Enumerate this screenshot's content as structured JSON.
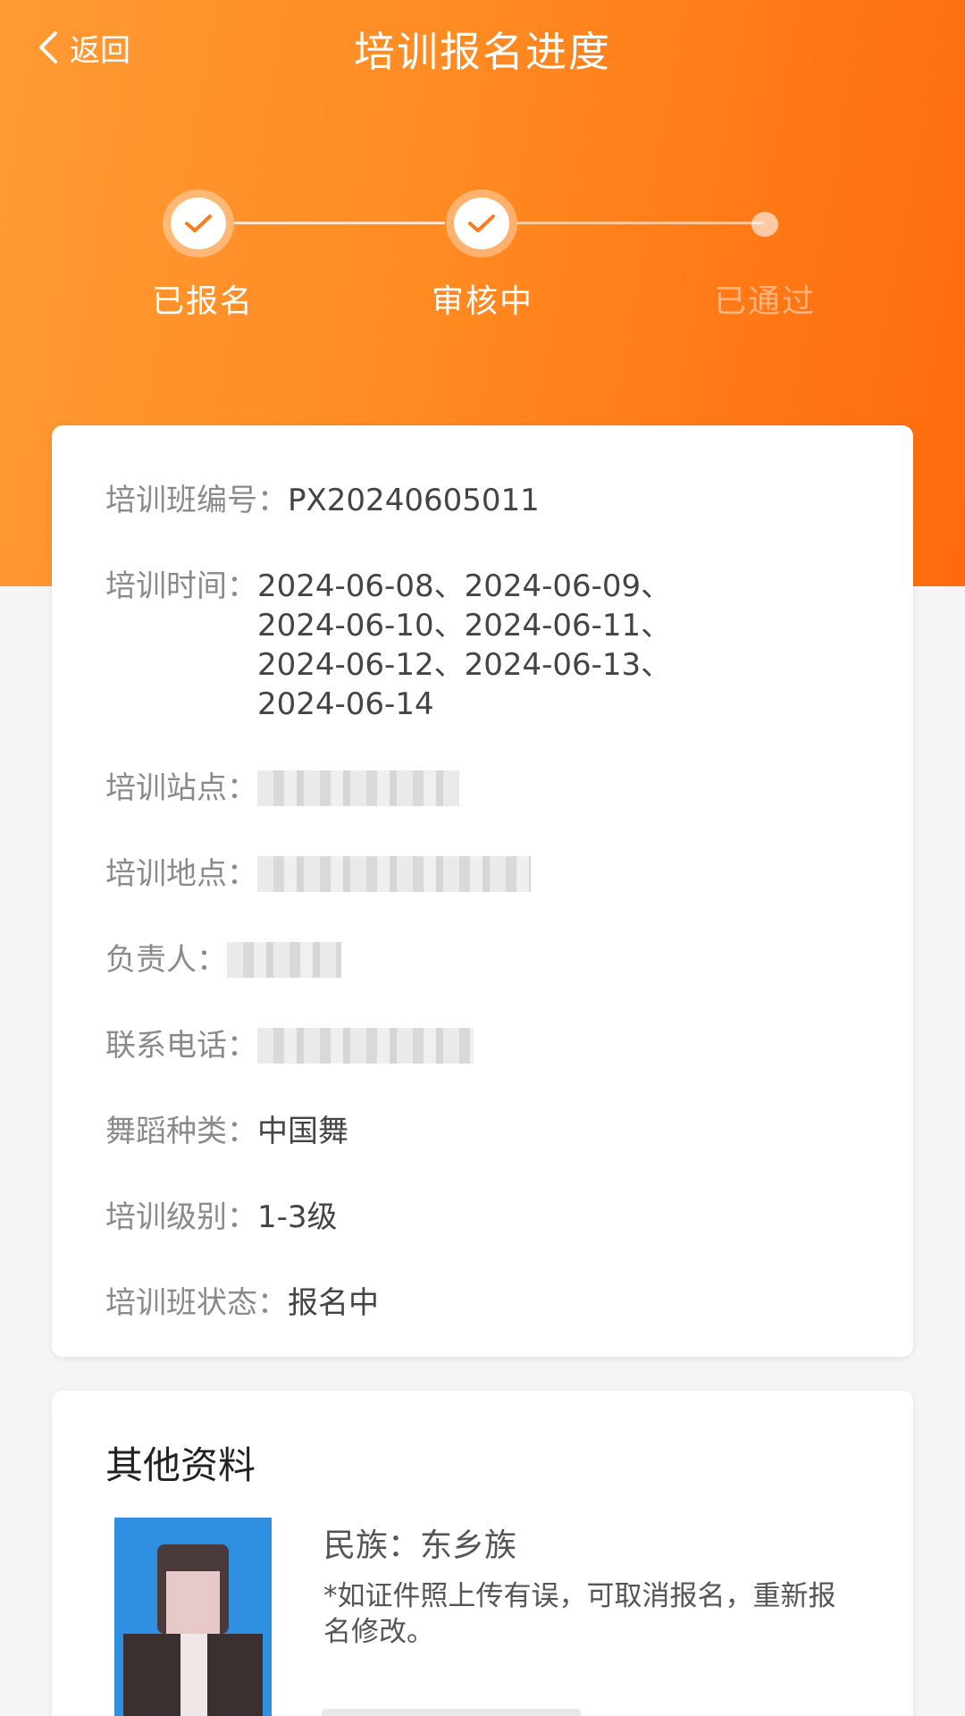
{
  "header": {
    "back_label": "返回",
    "title": "培训报名进度"
  },
  "steps": [
    {
      "label": "已报名",
      "state": "done"
    },
    {
      "label": "审核中",
      "state": "done"
    },
    {
      "label": "已通过",
      "state": "pending"
    }
  ],
  "info": {
    "class_no_label": "培训班编号：",
    "class_no": "PX20240605011",
    "time_label": "培训时间：",
    "time_lines": [
      "2024-06-08、2024-06-09、",
      "2024-06-10、2024-06-11、",
      "2024-06-12、2024-06-13、",
      "2024-06-14"
    ],
    "site_label": "培训站点：",
    "location_label": "培训地点：",
    "person_label": "负责人：",
    "phone_label": "联系电话：",
    "dance_label": "舞蹈种类：",
    "dance": "中国舞",
    "level_label": "培训级别：",
    "level": "1-3级",
    "status_label": "培训班状态：",
    "status": "报名中"
  },
  "other": {
    "title": "其他资料",
    "ethnic": "民族：东乡族",
    "note": "*如证件照上传有误，可取消报名，重新报名修改。"
  },
  "colors": {
    "gradient_start": "#ff9a33",
    "gradient_end": "#ff6a0c",
    "accent": "#ff7a1a"
  }
}
